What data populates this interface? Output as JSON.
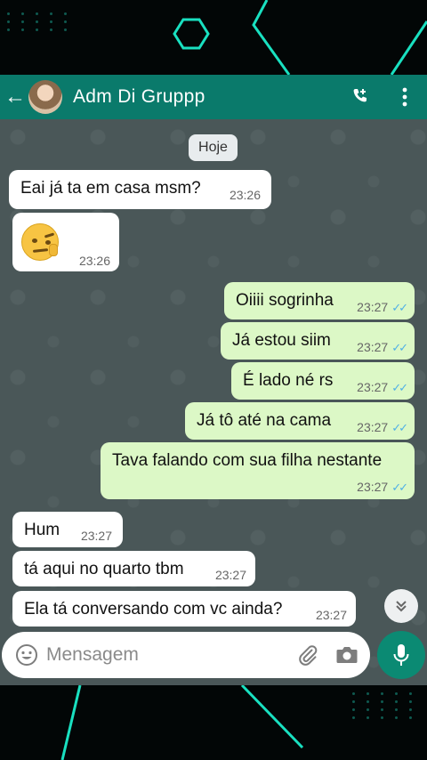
{
  "header": {
    "back_icon": "arrow-left-icon",
    "contact_name": "Adm Di Gruppp",
    "call_icon": "add-call-icon",
    "menu_icon": "more-vertical-icon",
    "bar_color": "#0a7a6b"
  },
  "date_divider": "Hoje",
  "messages": [
    {
      "direction": "in",
      "text": "Eai já ta em casa msm?",
      "time": "23:26"
    },
    {
      "direction": "in",
      "emoji": "face-with-raised-eyebrow-hand",
      "text": "",
      "time": "23:26"
    },
    {
      "direction": "out",
      "text": "Oiiii sogrinha",
      "time": "23:27",
      "status": "read"
    },
    {
      "direction": "out",
      "text": "Já estou siim",
      "time": "23:27",
      "status": "read"
    },
    {
      "direction": "out",
      "text": "É  lado né rs",
      "time": "23:27",
      "status": "read"
    },
    {
      "direction": "out",
      "text": "Já tô até na cama",
      "time": "23:27",
      "status": "read"
    },
    {
      "direction": "out",
      "text": "Tava falando com sua filha nestante",
      "time": "23:27",
      "status": "read"
    },
    {
      "direction": "in",
      "text": "Hum",
      "time": "23:27"
    },
    {
      "direction": "in",
      "text": "tá aqui no quarto tbm",
      "time": "23:27"
    },
    {
      "direction": "in",
      "text": "Ela tá conversando com vc ainda?",
      "time": "23:27"
    }
  ],
  "composer": {
    "placeholder": "Mensagem",
    "emoji_icon": "emoji-icon",
    "attach_icon": "paperclip-icon",
    "camera_icon": "camera-icon",
    "mic_icon": "microphone-icon",
    "mic_color": "#0b8a73"
  },
  "scroll_button_icon": "double-chevron-down-icon",
  "colors": {
    "incoming": "#ffffff",
    "outgoing": "#dcf8c6",
    "read_ticks": "#4fb0e6",
    "chat_background": "#4a5758"
  }
}
